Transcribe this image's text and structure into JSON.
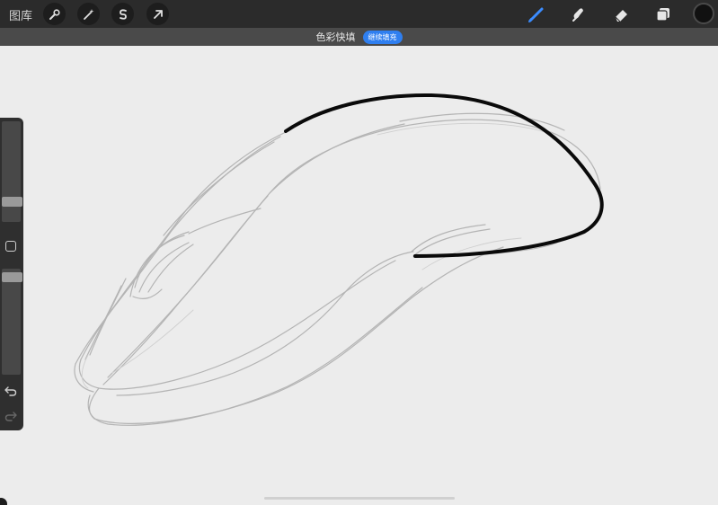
{
  "topbar": {
    "gallery_label": "图库",
    "left_tools": [
      {
        "icon": "wrench-icon",
        "name": "actions-button"
      },
      {
        "icon": "magic-wand-icon",
        "name": "adjustments-button"
      },
      {
        "icon": "selection-s-icon",
        "name": "selection-button"
      },
      {
        "icon": "arrow-cursor-icon",
        "name": "transform-button"
      }
    ],
    "right_tools": [
      {
        "icon": "brush-icon",
        "name": "brush-button",
        "active": true
      },
      {
        "icon": "smudge-icon",
        "name": "smudge-button",
        "active": false
      },
      {
        "icon": "eraser-icon",
        "name": "eraser-button",
        "active": false
      },
      {
        "icon": "layers-icon",
        "name": "layers-button",
        "active": false
      }
    ],
    "current_color": "#111111"
  },
  "banner": {
    "text": "色彩快填",
    "pill_label": "继续填充"
  },
  "colors": {
    "accent": "#2f7ff0",
    "canvas": "#ececec",
    "toolbar": "#2b2b2b"
  }
}
